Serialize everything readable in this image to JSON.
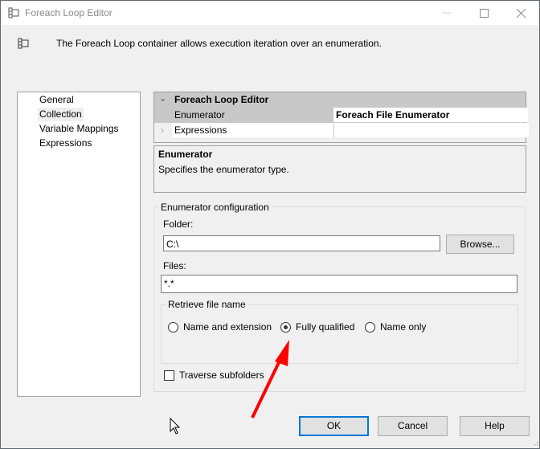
{
  "window": {
    "title": "Foreach Loop Editor",
    "minimize_icon": "minimize-icon",
    "maximize_icon": "maximize-icon",
    "close_icon": "close-icon"
  },
  "header": {
    "icon": "foreach-loop-icon",
    "description": "The Foreach Loop container allows execution iteration over an enumeration."
  },
  "nav": {
    "items": [
      {
        "label": "General",
        "selected": false
      },
      {
        "label": "Collection",
        "selected": true
      },
      {
        "label": "Variable Mappings",
        "selected": false
      },
      {
        "label": "Expressions",
        "selected": false
      }
    ]
  },
  "property_grid": {
    "category": "Foreach Loop Editor",
    "rows": [
      {
        "name": "Enumerator",
        "value": "Foreach File Enumerator"
      },
      {
        "name": "Expressions",
        "value": ""
      }
    ]
  },
  "description_panel": {
    "title": "Enumerator",
    "text": "Specifies the enumerator type."
  },
  "enumerator_config": {
    "legend": "Enumerator configuration",
    "folder_label": "Folder:",
    "folder_value": "C:\\",
    "browse_label": "Browse...",
    "files_label": "Files:",
    "files_value": "*.*",
    "retrieve_legend": "Retrieve file name",
    "options": [
      {
        "label": "Name and extension",
        "checked": false
      },
      {
        "label": "Fully qualified",
        "checked": true
      },
      {
        "label": "Name only",
        "checked": false
      }
    ],
    "traverse_label": "Traverse subfolders",
    "traverse_checked": false
  },
  "footer": {
    "ok_label": "OK",
    "cancel_label": "Cancel",
    "help_label": "Help"
  },
  "annotation": {
    "arrow_color": "#ff0000"
  }
}
